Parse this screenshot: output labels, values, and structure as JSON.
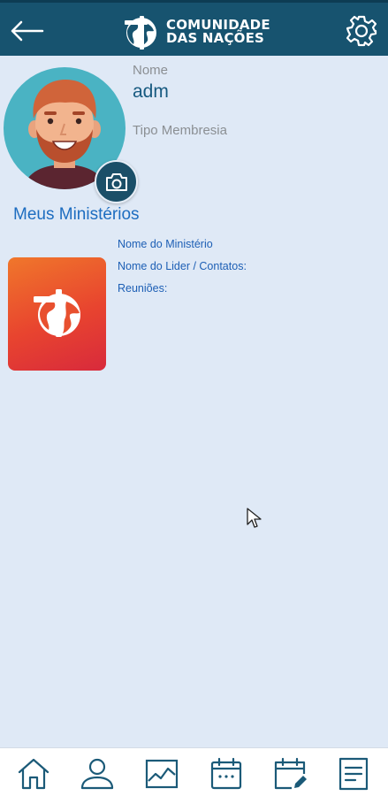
{
  "header": {
    "logo_line1": "COMUNIDADE",
    "logo_line2": "DAS NAÇÕES",
    "bar_color": "#17536f"
  },
  "profile": {
    "name_label": "Nome",
    "name_value": "adm",
    "membership_label": "Tipo Membresia",
    "membership_value": ""
  },
  "ministries": {
    "section_title": "Meus Ministérios",
    "items": [
      {
        "name_label": "Nome do Ministério",
        "leader_label": "Nome do Lider / Contatos:",
        "meetings_label": "Reuniões:"
      }
    ]
  },
  "bottom_nav": {
    "items": [
      {
        "icon": "home-icon"
      },
      {
        "icon": "user-icon"
      },
      {
        "icon": "chart-icon"
      },
      {
        "icon": "calendar-icon"
      },
      {
        "icon": "calendar-edit-icon"
      },
      {
        "icon": "document-icon"
      }
    ]
  },
  "colors": {
    "background": "#dfe9f6",
    "accent_blue": "#1d6dc0",
    "nav_icon": "#1b5a78"
  }
}
